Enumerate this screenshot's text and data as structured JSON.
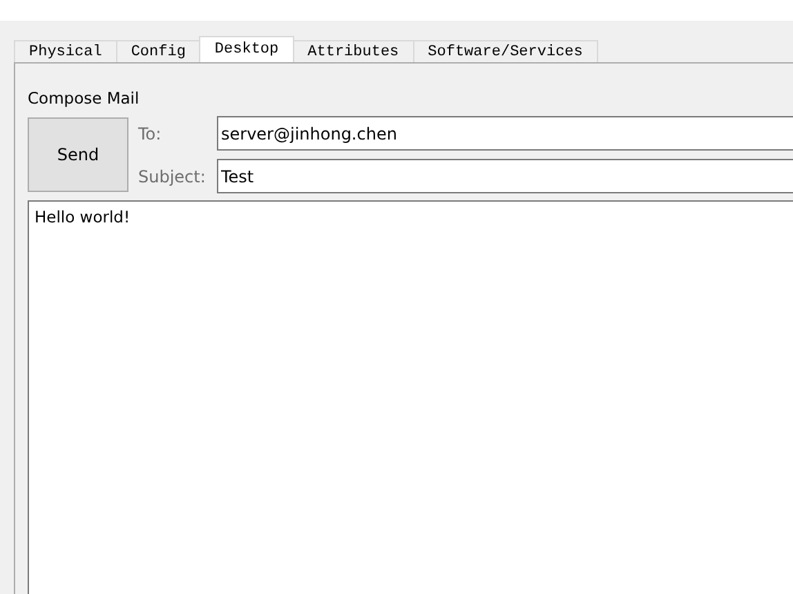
{
  "tabs": [
    {
      "label": "Physical",
      "selected": false
    },
    {
      "label": "Config",
      "selected": false
    },
    {
      "label": "Desktop",
      "selected": true
    },
    {
      "label": "Attributes",
      "selected": false
    },
    {
      "label": "Software/Services",
      "selected": false
    }
  ],
  "compose": {
    "heading": "Compose Mail",
    "send_button": "Send",
    "to_label": "To:",
    "to_value": "server@jinhong.chen",
    "subject_label": "Subject:",
    "subject_value": "Test",
    "body": "Hello world!"
  }
}
